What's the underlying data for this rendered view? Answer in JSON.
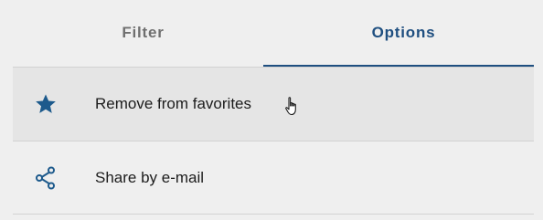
{
  "tabs": [
    {
      "label": "Filter",
      "active": false
    },
    {
      "label": "Options",
      "active": true
    }
  ],
  "menu": {
    "items": [
      {
        "label": "Remove from favorites",
        "icon": "star-icon",
        "hovered": true
      },
      {
        "label": "Share by e-mail",
        "icon": "share-icon",
        "hovered": false
      }
    ]
  },
  "colors": {
    "accent": "#1f4f80",
    "icon": "#1d5a8c",
    "inactive_tab_text": "#6f6f6f",
    "hover_background": "#e5e5e5",
    "background": "#efefef"
  }
}
